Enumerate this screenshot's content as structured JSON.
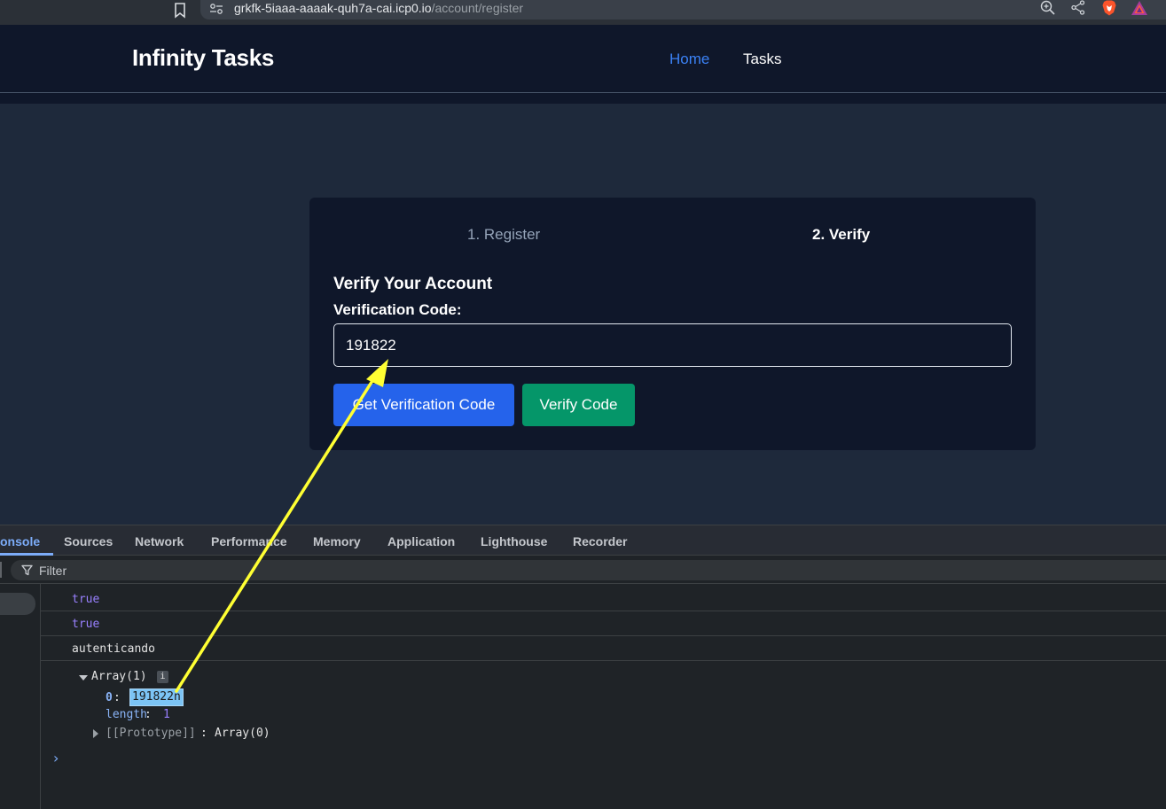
{
  "browser": {
    "url_host": "grkfk-5iaaa-aaaak-quh7a-cai.icp0.io",
    "url_path": "/account/register",
    "icons": [
      "bookmark-icon",
      "site-settings-icon",
      "zoom-icon",
      "share-icon",
      "brave-shields-icon",
      "brave-rewards-icon"
    ]
  },
  "navbar": {
    "brand": "Infinity Tasks",
    "links": [
      {
        "label": "Home",
        "active": true
      },
      {
        "label": "Tasks",
        "active": false
      }
    ]
  },
  "card": {
    "steps": [
      {
        "label": "1. Register",
        "active": false
      },
      {
        "label": "2. Verify",
        "active": true
      }
    ],
    "heading": "Verify Your Account",
    "field_label": "Verification Code:",
    "code_value": "191822",
    "buttons": {
      "get_code": "Get Verification Code",
      "verify": "Verify Code"
    }
  },
  "devtools": {
    "tabs": [
      "onsole",
      "Sources",
      "Network",
      "Performance",
      "Memory",
      "Application",
      "Lighthouse",
      "Recorder"
    ],
    "active_tab": "onsole",
    "filter_placeholder": "Filter",
    "logs": [
      "true",
      "true",
      "autenticando"
    ],
    "array": {
      "header": "Array(1)",
      "info_badge": "i",
      "index_key": "0",
      "index_value": "191822n",
      "length_key": "length",
      "length_value": "1",
      "prototype_key": "[[Prototype]]",
      "prototype_value": "Array(0)"
    },
    "prompt": "›"
  },
  "colors": {
    "page_bg": "#1e293b",
    "navbar_bg": "#0f172a",
    "nav_active": "#3b82f6",
    "btn_primary": "#2563eb",
    "btn_success": "#059669",
    "annotation_arrow": "#ffff33"
  }
}
